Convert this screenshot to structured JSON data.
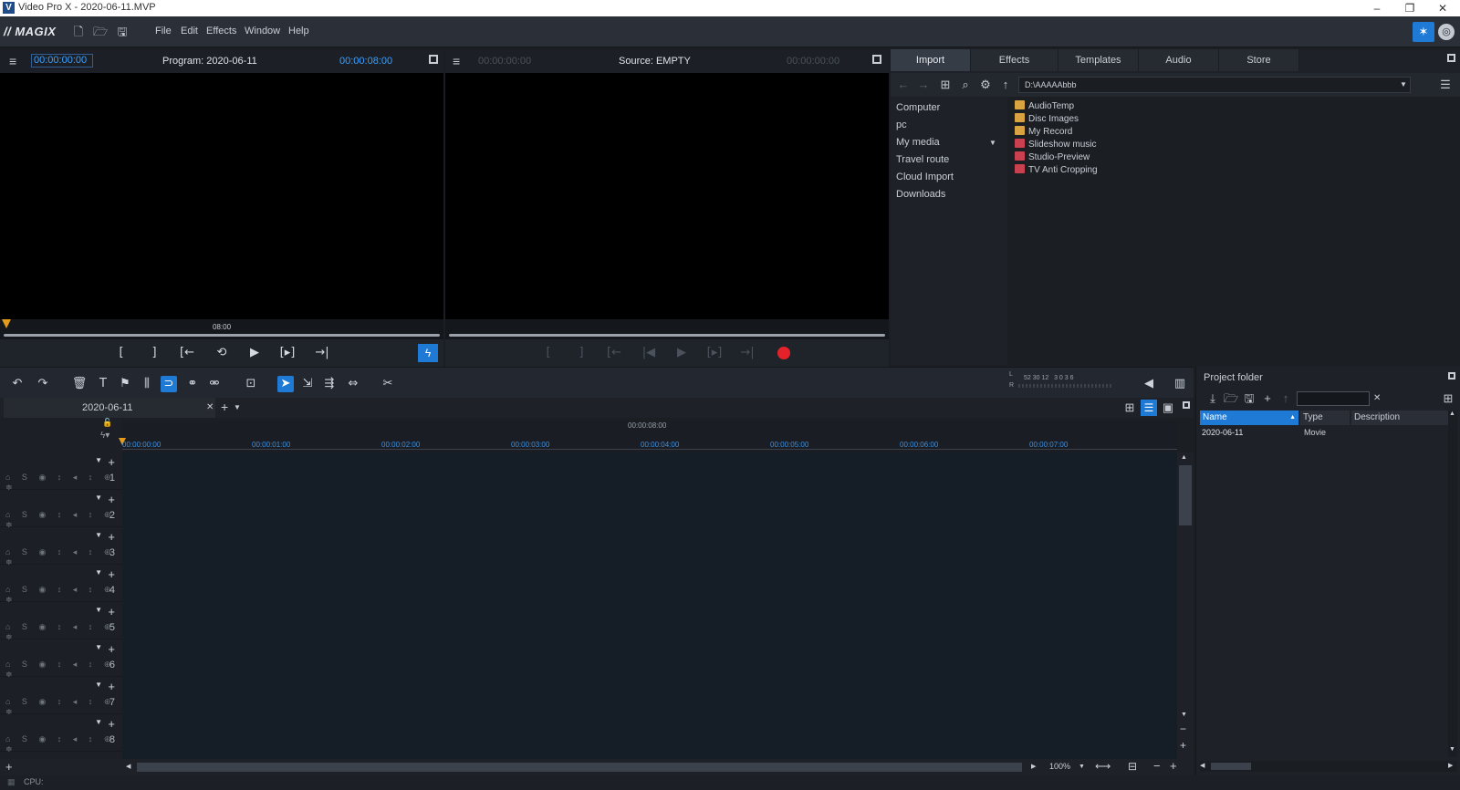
{
  "window": {
    "title": "Video Pro X - 2020-06-11.MVP",
    "app_icon": "V",
    "minimize": "–",
    "restore": "❐",
    "close": "✕"
  },
  "menubar": {
    "logo": "MAGIX",
    "items": [
      "File",
      "Edit",
      "Effects",
      "Window",
      "Help"
    ]
  },
  "program_monitor": {
    "menu_icon": "≡",
    "timecode_left": "00:00:00:00",
    "title": "Program: 2020-06-11",
    "timecode_right": "00:00:08:00",
    "scrub_label": "08:00",
    "transport": [
      "[",
      "]",
      "[←",
      "⟲",
      "▶",
      "[▸]",
      "→|"
    ]
  },
  "source_monitor": {
    "menu_icon": "≡",
    "timecode_left": "00:00:00:00",
    "title": "Source: EMPTY",
    "timecode_right": "00:00:00:00",
    "transport": [
      "[",
      "]",
      "[←",
      "|◀",
      "▶",
      "[▸]",
      "→|"
    ]
  },
  "import_panel": {
    "tabs": [
      "Import",
      "Effects",
      "Templates",
      "Audio",
      "Store"
    ],
    "path": "D:\\AAAAAbbb",
    "tree": [
      "Computer",
      "pc",
      "My media",
      "Travel route",
      "Cloud Import",
      "Downloads"
    ],
    "files": [
      {
        "name": "AudioTemp",
        "color": "#d9a341"
      },
      {
        "name": "Disc Images",
        "color": "#d9a341"
      },
      {
        "name": "My Record",
        "color": "#d9a341"
      },
      {
        "name": "Slideshow music",
        "color": "#c9414f"
      },
      {
        "name": "Studio-Preview",
        "color": "#c9414f"
      },
      {
        "name": "TV Anti Cropping",
        "color": "#c9414f"
      }
    ]
  },
  "timeline": {
    "tab_name": "2020-06-11",
    "tab_close": "✕",
    "tab_add": "+",
    "ruler_center": "00:00:08:00",
    "ruler_ticks": [
      "00:00:00:00",
      "00:00:01:00",
      "00:00:02:00",
      "00:00:03:00",
      "00:00:04:00",
      "00:00:05:00",
      "00:00:06:00",
      "00:00:07:00"
    ],
    "tracks": [
      "1",
      "2",
      "3",
      "4",
      "5",
      "6",
      "7",
      "8"
    ],
    "track_controls": "⌂ S ◉ ↕ ◂ ↕ ⊕ ≑",
    "meter_labels": "52 30 12   3 0 3 6",
    "zoom": "100%"
  },
  "project_folder": {
    "title": "Project folder",
    "columns": [
      "Name",
      "Type",
      "Description"
    ],
    "rows": [
      {
        "name": "2020-06-11",
        "type": "Movie",
        "description": ""
      }
    ]
  },
  "status": {
    "cpu_label": "CPU:"
  },
  "colors": {
    "accent": "#1f7ad6",
    "timecode": "#3aa0ff",
    "record": "#e5212a"
  }
}
